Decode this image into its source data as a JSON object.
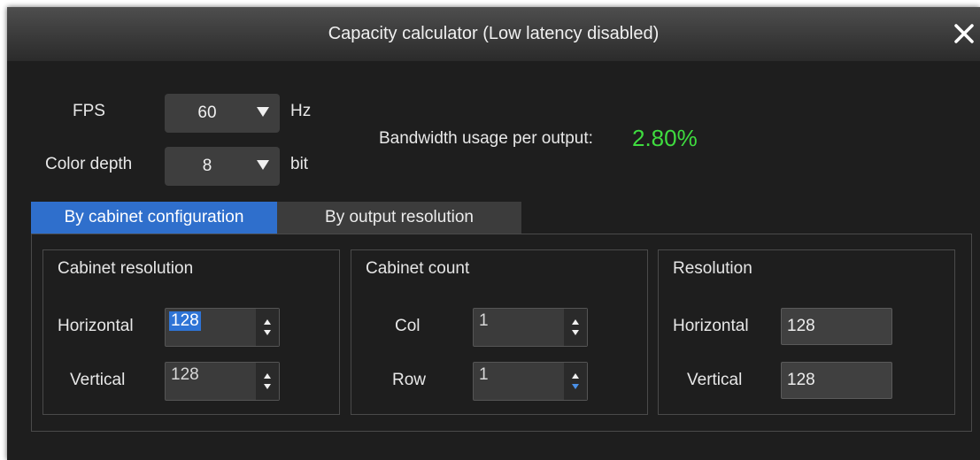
{
  "window": {
    "title": "Capacity calculator (Low latency disabled)"
  },
  "settings": {
    "fps_label": "FPS",
    "fps_value": "60",
    "fps_unit": "Hz",
    "color_depth_label": "Color depth",
    "color_depth_value": "8",
    "color_depth_unit": "bit"
  },
  "bandwidth": {
    "label": "Bandwidth usage per output:",
    "value": "2.80%",
    "value_color": "#3fdc3f"
  },
  "tabs": [
    {
      "label": "By cabinet configuration",
      "active": true
    },
    {
      "label": "By output resolution",
      "active": false
    }
  ],
  "cabinet_resolution": {
    "title": "Cabinet resolution",
    "horizontal_label": "Horizontal",
    "horizontal_value": "128",
    "vertical_label": "Vertical",
    "vertical_value": "128"
  },
  "cabinet_count": {
    "title": "Cabinet count",
    "col_label": "Col",
    "col_value": "1",
    "row_label": "Row",
    "row_value": "1"
  },
  "resolution": {
    "title": "Resolution",
    "horizontal_label": "Horizontal",
    "horizontal_value": "128",
    "vertical_label": "Vertical",
    "vertical_value": "128"
  },
  "colors": {
    "accent": "#2f6fcc",
    "background": "#1e1e1e",
    "bandwidth_value": "#3fdc3f"
  },
  "icons": {
    "close": "close-icon",
    "dropdown": "triangle-down-icon",
    "spinner": "up-down-arrows-icon"
  }
}
